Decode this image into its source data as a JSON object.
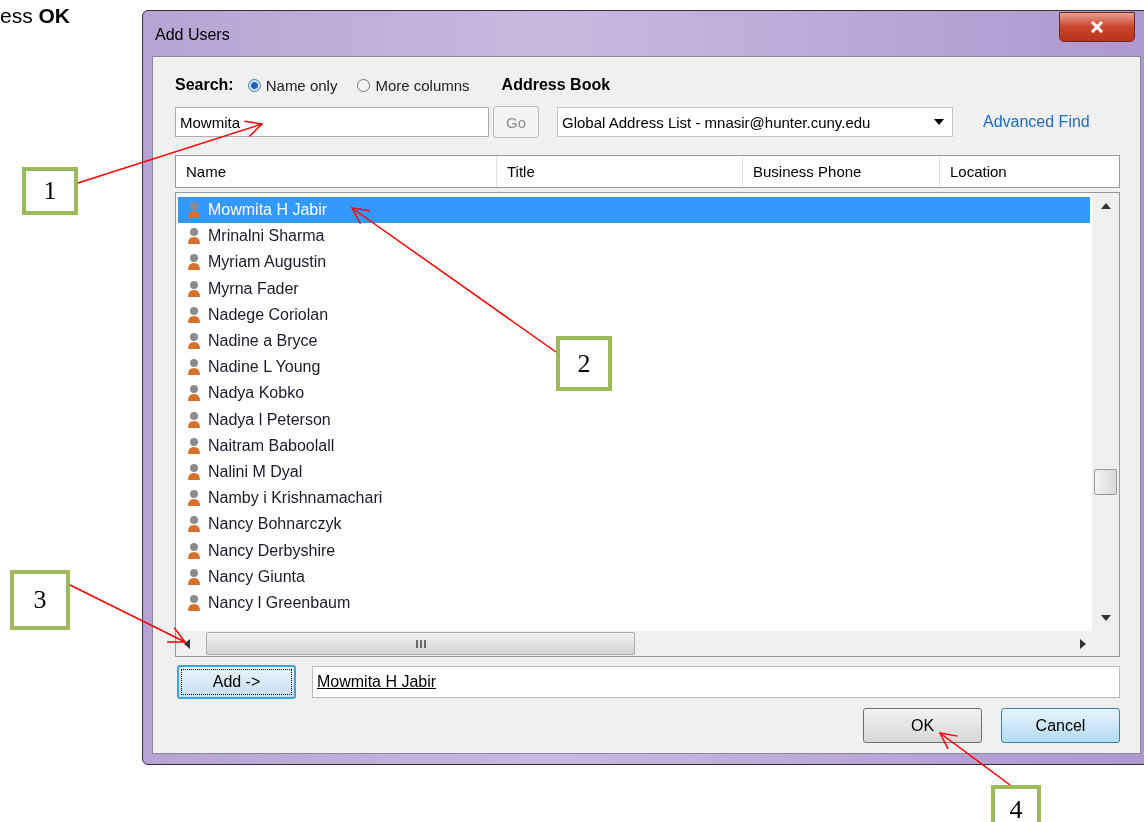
{
  "instruction": "ess **OK**",
  "window": {
    "title": "Add Users"
  },
  "search": {
    "label": "Search:",
    "options": [
      {
        "label": "Name only",
        "selected": true
      },
      {
        "label": "More columns",
        "selected": false
      }
    ],
    "value": "Mowmita",
    "go_button": {
      "label": "Go",
      "disabled": true
    }
  },
  "address_book": {
    "label": "Address Book",
    "value": "Global Address List - mnasir@hunter.cuny.edu",
    "advanced_find": "Advanced Find"
  },
  "table": {
    "columns": [
      "Name",
      "Title",
      "Business Phone",
      "Location"
    ],
    "rows": [
      {
        "name": "Mowmita H Jabir",
        "selected": true
      },
      {
        "name": "Mrinalni Sharma",
        "selected": false
      },
      {
        "name": "Myriam Augustin",
        "selected": false
      },
      {
        "name": "Myrna Fader",
        "selected": false
      },
      {
        "name": "Nadege Coriolan",
        "selected": false
      },
      {
        "name": "Nadine a Bryce",
        "selected": false
      },
      {
        "name": "Nadine L Young",
        "selected": false
      },
      {
        "name": "Nadya Kobko",
        "selected": false
      },
      {
        "name": "Nadya l Peterson",
        "selected": false
      },
      {
        "name": "Naitram Baboolall",
        "selected": false
      },
      {
        "name": "Nalini M Dyal",
        "selected": false
      },
      {
        "name": "Namby i Krishnamachari",
        "selected": false
      },
      {
        "name": "Nancy Bohnarczyk",
        "selected": false
      },
      {
        "name": "Nancy Derbyshire",
        "selected": false
      },
      {
        "name": "Nancy Giunta",
        "selected": false
      },
      {
        "name": "Nancy l Greenbaum",
        "selected": false
      }
    ]
  },
  "add": {
    "button": "Add ->",
    "value": "Mowmita H Jabir"
  },
  "buttons": [
    {
      "label": "OK",
      "default": false
    },
    {
      "label": "Cancel",
      "default": true
    }
  ],
  "callouts": [
    "1",
    "2",
    "3",
    "4"
  ]
}
